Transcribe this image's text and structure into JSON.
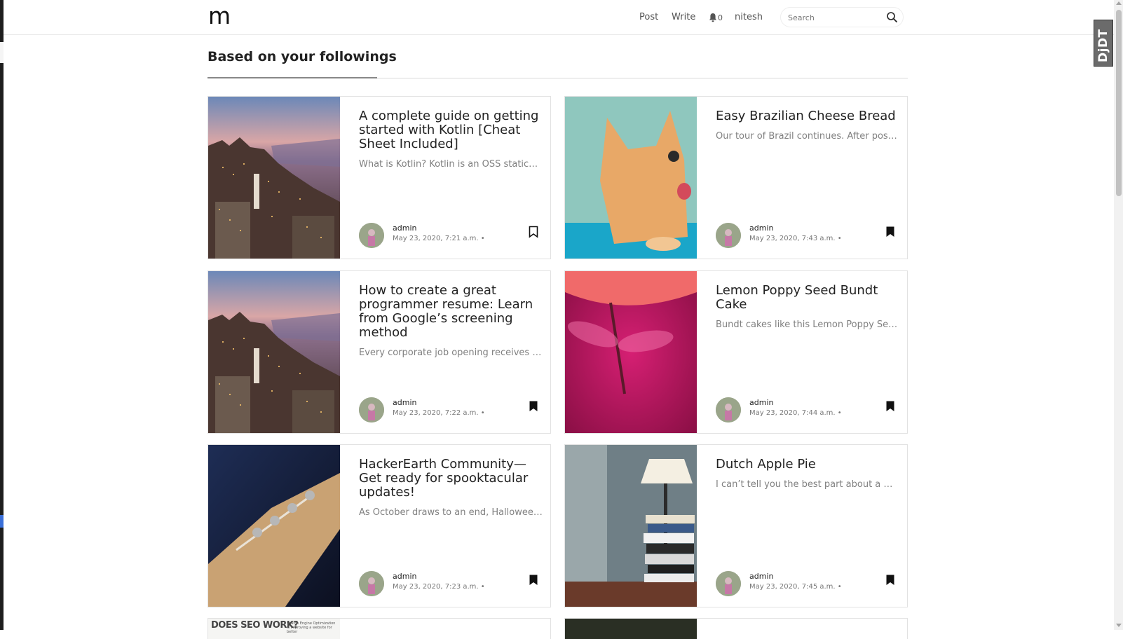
{
  "header": {
    "logo": "m",
    "nav": [
      {
        "label": "Post"
      },
      {
        "label": "Write"
      }
    ],
    "notification_count": "0",
    "username": "nitesh",
    "search_placeholder": "Search"
  },
  "section": {
    "heading": "Based on your followings"
  },
  "posts": [
    {
      "title": "A complete guide on getting started with Kotlin [Cheat Sheet Included]",
      "excerpt": "What is Kotlin? Kotlin is an OSS statically typed",
      "author": "admin",
      "date": "May 23, 2020, 7:21 a.m. •",
      "bookmarked": false,
      "image": "city-skyline-icon"
    },
    {
      "title": "Easy Brazilian Cheese Bread",
      "excerpt": "Our tour of Brazil continues. After posting about",
      "author": "admin",
      "date": "May 23, 2020, 7:43 a.m. •",
      "bookmarked": true,
      "image": "kitten-icon"
    },
    {
      "title": "How to create a great programmer resume: Learn from Google’s screening method",
      "excerpt": "Every corporate job opening receives a lot of",
      "author": "admin",
      "date": "May 23, 2020, 7:22 a.m. •",
      "bookmarked": true,
      "image": "city-skyline-icon"
    },
    {
      "title": "Lemon Poppy Seed Bundt Cake",
      "excerpt": "Bundt cakes like this Lemon Poppy Seed Bundt",
      "author": "admin",
      "date": "May 23, 2020, 7:44 a.m. •",
      "bookmarked": true,
      "image": "dragonfly-icon"
    },
    {
      "title": "HackerEarth Community—Get ready for spooktacular updates!",
      "excerpt": "As October draws to an end, Halloween arrives",
      "author": "admin",
      "date": "May 23, 2020, 7:23 a.m. •",
      "bookmarked": true,
      "image": "guitar-icon"
    },
    {
      "title": "Dutch Apple Pie",
      "excerpt": "I can’t tell you the best part about a Dutch",
      "author": "admin",
      "date": "May 23, 2020, 7:45 a.m. •",
      "bookmarked": true,
      "image": "lamp-books-icon"
    }
  ],
  "partial": {
    "seo_title": "DOES SEO WORK?",
    "seo_sub": "Search Engine Optimization is improving a website for better"
  },
  "badge": {
    "text": "DjDT"
  },
  "colors": {
    "accent": "#222222",
    "muted": "#808080",
    "border": "#e2e2e2"
  }
}
